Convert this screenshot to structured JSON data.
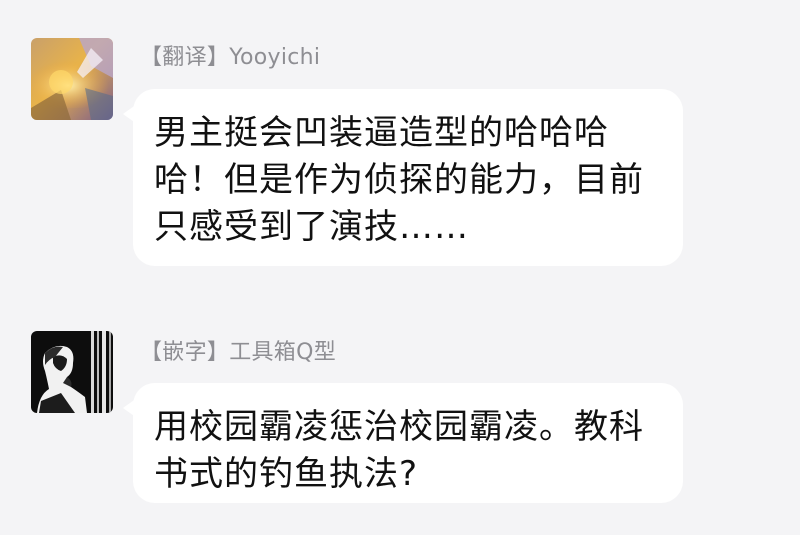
{
  "messages": [
    {
      "sender_tag": "【翻译】",
      "sender_name": "Yooyichi",
      "avatar_icon": "abstract-colorful-avatar",
      "text": "男主挺会凹装逼造型的哈哈哈哈！但是作为侦探的能力，目前只感受到了演技……"
    },
    {
      "sender_tag": "【嵌字】",
      "sender_name": "工具箱Q型",
      "avatar_icon": "dark-portrait-avatar",
      "text": "用校园霸凌惩治校园霸凌。教科书式的钓鱼执法?"
    }
  ],
  "colors": {
    "background": "#f4f4f6",
    "bubble": "#ffffff",
    "sender_text": "#8e8e93",
    "message_text": "#111111"
  }
}
